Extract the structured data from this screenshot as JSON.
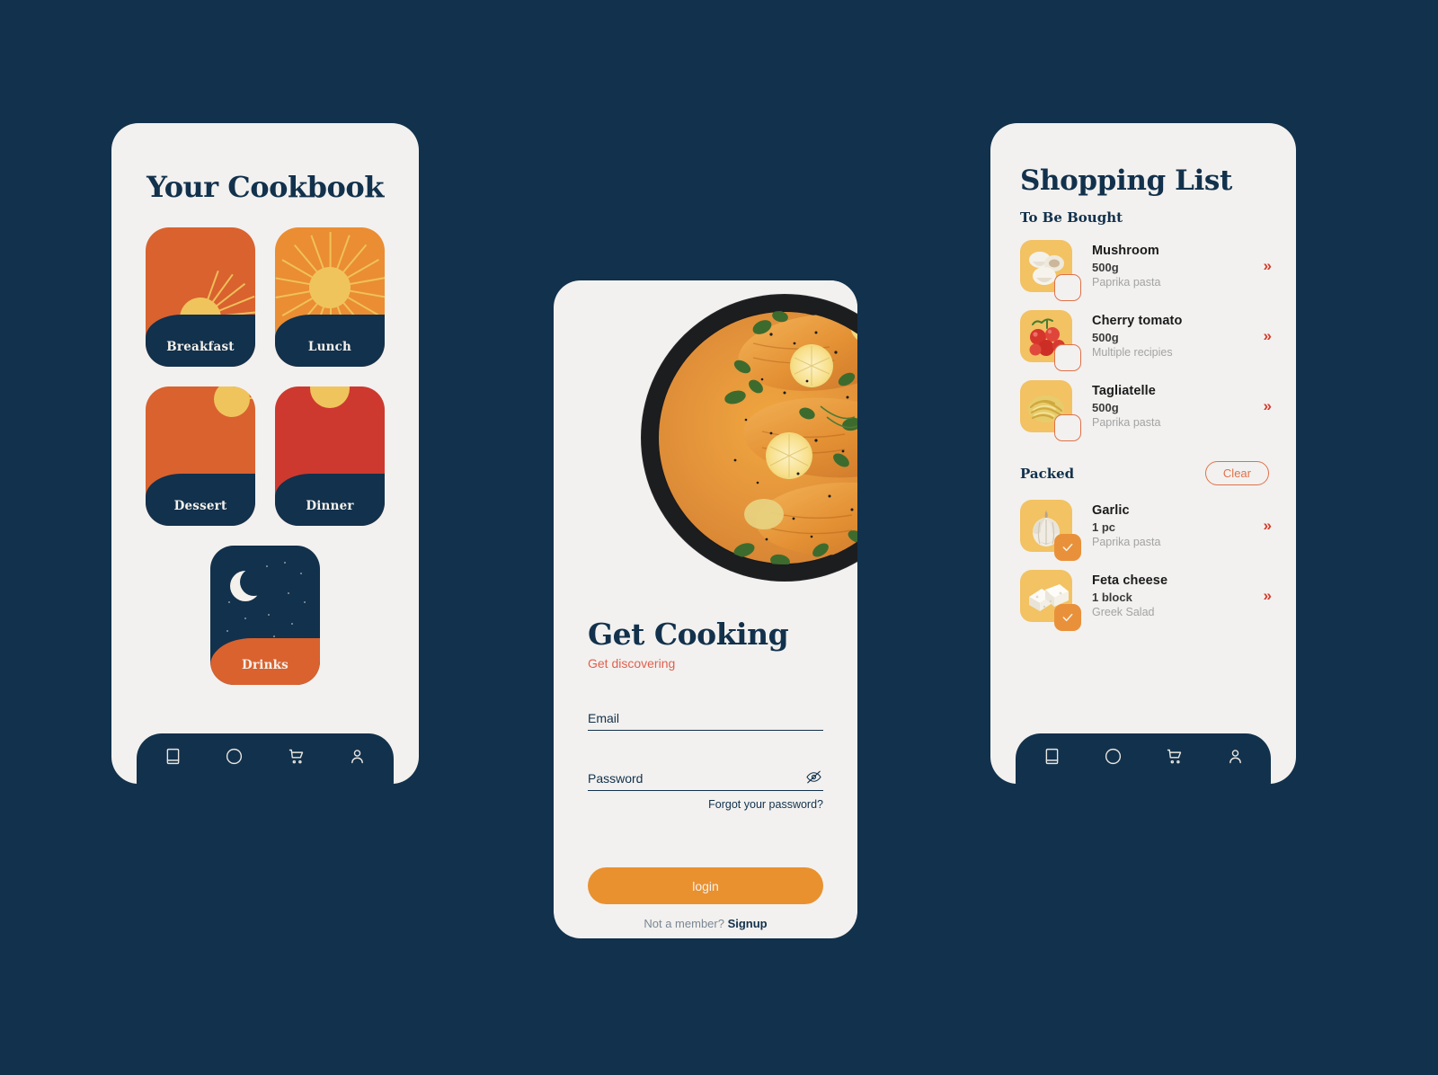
{
  "theme": {
    "background": "#12314c",
    "card": "#f2f1ef",
    "navy": "#12314c",
    "orange": "#d9622f",
    "amber": "#ea8d33",
    "red": "#cd392f",
    "yellow": "#f0c45c",
    "accent_button": "#e9912f",
    "coral": "#e0604f",
    "thumb_bg": "#f2c263"
  },
  "cookbook": {
    "title": "Your Cookbook",
    "cards": [
      {
        "label": "Breakfast",
        "scene": "sunrise"
      },
      {
        "label": "Lunch",
        "scene": "sun"
      },
      {
        "label": "Dessert",
        "scene": "sun-corner"
      },
      {
        "label": "Dinner",
        "scene": "sunset"
      },
      {
        "label": "Drinks",
        "scene": "night"
      }
    ]
  },
  "nav": {
    "items": [
      {
        "icon": "book-icon",
        "name": "nav-book"
      },
      {
        "icon": "compass-icon",
        "name": "nav-discover"
      },
      {
        "icon": "cart-icon",
        "name": "nav-cart"
      },
      {
        "icon": "person-icon",
        "name": "nav-profile"
      }
    ]
  },
  "login": {
    "hero_alt": "salmon fillets in creamy paprika sauce with lemon slices and herbs in a black pan",
    "title": "Get Cooking",
    "subtitle": "Get discovering",
    "email": {
      "placeholder": "Email",
      "value": ""
    },
    "password": {
      "placeholder": "Password",
      "value": "",
      "toggle_icon": "eye-slash-icon"
    },
    "forgot_label": "Forgot your password?",
    "login_label": "login",
    "member_prompt": "Not a member? ",
    "signup_label": "Signup"
  },
  "shopping": {
    "title": "Shopping List",
    "sections": [
      {
        "label": "To Be Bought",
        "action": null,
        "items": [
          {
            "name": "Mushroom",
            "qty": "500g",
            "recipe": "Paprika pasta",
            "checked": false,
            "thumb": "mushroom"
          },
          {
            "name": "Cherry tomato",
            "qty": "500g",
            "recipe": "Multiple recipies",
            "checked": false,
            "thumb": "tomato"
          },
          {
            "name": "Tagliatelle",
            "qty": "500g",
            "recipe": "Paprika pasta",
            "checked": false,
            "thumb": "pasta"
          }
        ]
      },
      {
        "label": "Packed",
        "action": "Clear",
        "items": [
          {
            "name": "Garlic",
            "qty": "1 pc",
            "recipe": "Paprika pasta",
            "checked": true,
            "thumb": "garlic"
          },
          {
            "name": "Feta cheese",
            "qty": "1 block",
            "recipe": "Greek Salad",
            "checked": true,
            "thumb": "feta"
          }
        ]
      }
    ],
    "arrow_glyph": "»"
  }
}
